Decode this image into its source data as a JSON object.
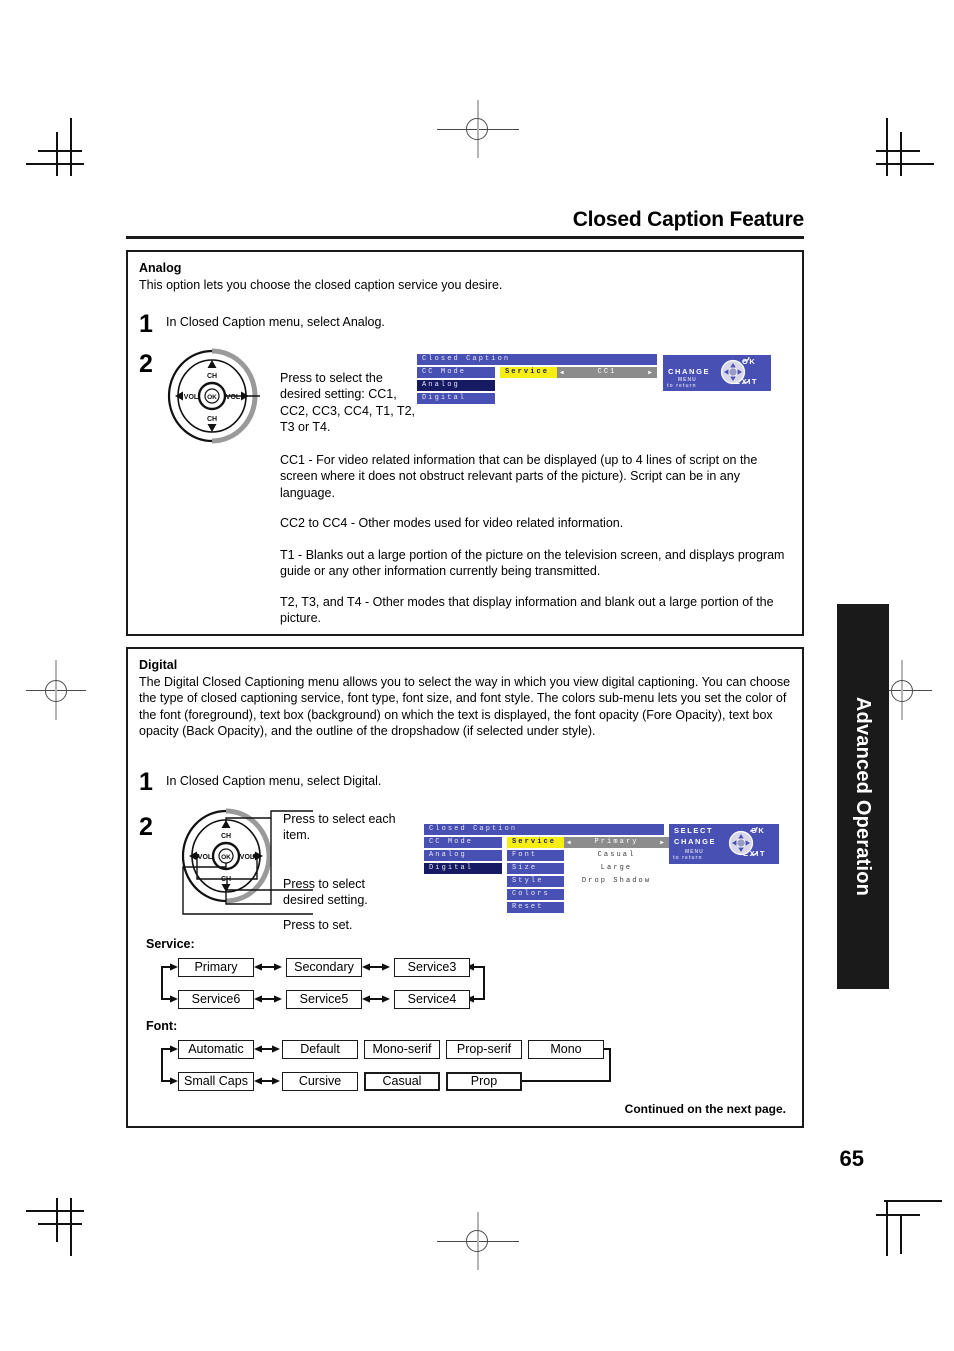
{
  "page": {
    "title": "Closed Caption Feature",
    "number": "65",
    "side_tab": "Advanced Operation",
    "continued": "Continued on the next page."
  },
  "analog": {
    "heading": "Analog",
    "intro": "This option lets you choose the closed caption service you desire.",
    "step1": {
      "num": "1",
      "text": "In Closed Caption menu, select Analog."
    },
    "step2": {
      "num": "2",
      "text": "Press to select the desired setting: CC1, CC2, CC3, CC4, T1, T2, T3 or T4."
    },
    "paragraphs": [
      "CC1 - For video related information that can be displayed (up to 4 lines of script on the screen where it does not obstruct relevant parts of the picture). Script can be in any language.",
      "CC2 to CC4 - Other modes used for video related information.",
      "T1 - Blanks out a large portion of the picture on the television screen, and displays program guide or any other information currently being transmitted.",
      "T2, T3, and T4 - Other modes that display information and blank out a large portion of the picture."
    ],
    "osd": {
      "title": "Closed Caption",
      "rows": [
        "CC Mode",
        "Analog",
        "Digital"
      ],
      "selected_row": "Analog",
      "highlight_label": "Service",
      "value": "CC1",
      "help": {
        "change": "CHANGE",
        "ok": "OK",
        "exit": "EXIT",
        "menu": "MENU",
        "to_return": "to return"
      }
    }
  },
  "digital": {
    "heading": "Digital",
    "intro": "The Digital Closed Captioning menu allows you to select the way in which you view digital captioning. You can choose the type of closed captioning service, font type, font size, and font style. The colors sub-menu lets you set the color of the font (foreground), text box (background) on which the text is displayed, the font opacity (Fore Opacity), text box opacity (Back Opacity), and the outline of the dropshadow (if selected under style).",
    "step1": {
      "num": "1",
      "text": "In Closed Caption menu, select Digital."
    },
    "step2": {
      "num": "2",
      "callout_item": "Press to select each item.",
      "callout_setting": "Press to select desired setting.",
      "callout_set": "Press to set."
    },
    "osd": {
      "title": "Closed Caption",
      "rows": [
        "CC Mode",
        "Analog",
        "Digital"
      ],
      "selected_row": "Digital",
      "submenu": [
        {
          "label": "Service",
          "value": "Primary",
          "highlight": true
        },
        {
          "label": "Font",
          "value": "Casual",
          "highlight": false
        },
        {
          "label": "Size",
          "value": "Large",
          "highlight": false
        },
        {
          "label": "Style",
          "value": "Drop Shadow",
          "highlight": false
        },
        {
          "label": "Colors",
          "value": "",
          "highlight": false
        },
        {
          "label": "Reset",
          "value": "",
          "highlight": false
        }
      ],
      "help": {
        "select": "SELECT",
        "change": "CHANGE",
        "ok": "OK",
        "exit": "EXIT",
        "menu": "MENU",
        "to_return": "to return"
      }
    },
    "service_flow": {
      "label": "Service:",
      "row1": [
        "Primary",
        "Secondary",
        "Service3"
      ],
      "row2": [
        "Service6",
        "Service5",
        "Service4"
      ]
    },
    "font_flow": {
      "label": "Font:",
      "row1": [
        "Automatic",
        "Default",
        "Mono-serif",
        "Prop-serif",
        "Mono"
      ],
      "row2": [
        "Small Caps",
        "Cursive",
        "Casual",
        "Prop"
      ]
    }
  },
  "remote": {
    "ch_up": "CH",
    "ch_down": "CH",
    "vol_left": "VOL",
    "vol_right": "VOL",
    "ok": "OK"
  },
  "colors": {
    "osd_blue": "#4850b4",
    "osd_selected": "#161a63",
    "osd_highlight": "#f6ee10",
    "osd_value_gray": "#8c8c8c",
    "ink": "#1a1a1a"
  }
}
